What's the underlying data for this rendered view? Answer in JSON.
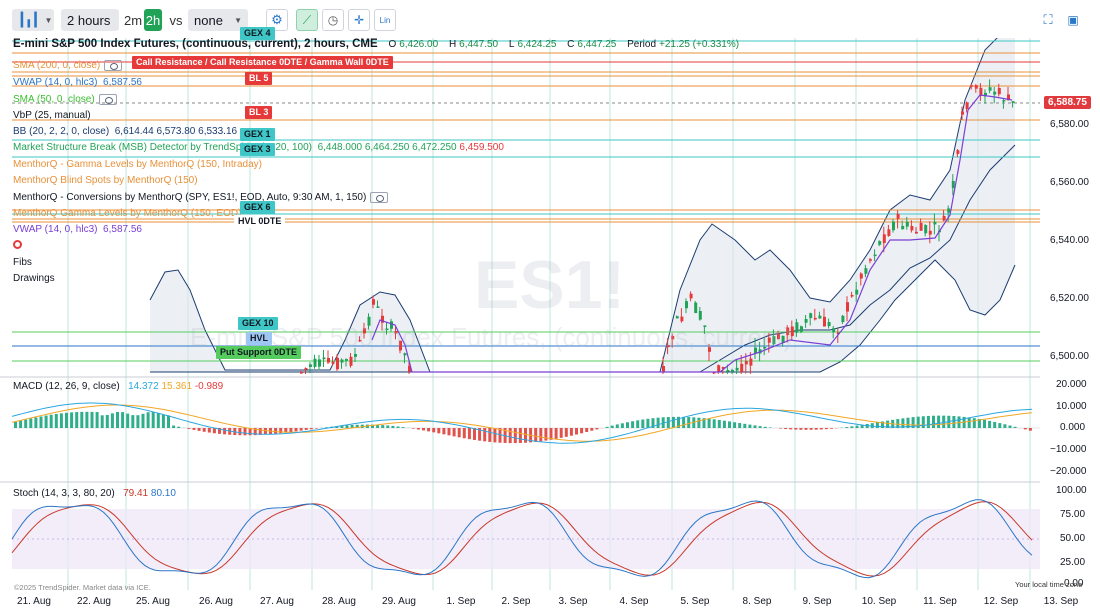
{
  "toolbar": {
    "interval_select": "2 hours",
    "interval_short_2m": "2m",
    "interval_short_2h": "2h",
    "compare_label": "vs",
    "compare_select": "none",
    "scale_label": "Lin"
  },
  "legend": {
    "title": "E-mini S&P 500 Index Futures, (continuous, current), 2 hours, CME",
    "open_label": "O",
    "open_value": "6,426.00",
    "high_label": "H",
    "high_value": "6,447.50",
    "low_label": "L",
    "low_value": "6,424.25",
    "close_label": "C",
    "close_value": "6,447.25",
    "period_label": "Period",
    "period_value": "+21.25 (+0.331%)",
    "indicators": [
      {
        "label": "SMA (200, 0, close)",
        "color": "#e8913a"
      },
      {
        "label": "VWAP (14, 0, hlc3)",
        "value": "6,587.56",
        "color": "#2a76c9"
      },
      {
        "label": "SMA (50, 0, close)",
        "color": "#3cbf2f"
      },
      {
        "label": "VbP (25, manual)",
        "color": "#131722"
      },
      {
        "label": "BB (20, 2, 2, 0, close)",
        "value": "6,614.44  6,573.80  6,533.16",
        "color": "#1b3c70"
      },
      {
        "label": "Market Structure Break (MSB) Detector by TrendSpider (3, 20, 100)",
        "value_green": "6,448.000  6,464.250  6,472.250",
        "value_red": "6,459.500",
        "color": "#21a357"
      },
      {
        "label": "MenthorQ - Gamma Levels by MenthorQ (150, Intraday)",
        "color": "#e8913a"
      },
      {
        "label": "MenthorQ Blind Spots by MenthorQ (150)",
        "color": "#e8913a"
      },
      {
        "label": "MenthorQ - Conversions by MenthorQ (SPY, ES1!, EOD, Auto, 9:30 AM, 1, 150)",
        "color": "#131722"
      },
      {
        "label": "MenthorQ Gamma Levels by MenthorQ (150, EOD)",
        "color": "#e8913a"
      },
      {
        "label": "VWAP (14, 0, hlc3)",
        "value": "6,587.56",
        "color": "#7b3fd6"
      },
      {
        "label": "Fibs",
        "color": "#131722"
      },
      {
        "label": "Drawings",
        "color": "#131722"
      }
    ]
  },
  "levels": {
    "gex4": "GEX 4",
    "call_resistance": "Call Resistance / Call Resistance 0DTE / Gamma Wall 0DTE",
    "bl5": "BL 5",
    "bl3": "BL 3",
    "gex1": "GEX 1",
    "gex3": "GEX 3",
    "gex6": "GEX 6",
    "hvl_0dte": "HVL 0DTE",
    "gex10": "GEX 10",
    "hvl": "HVL",
    "put_support": "Put Support 0DTE"
  },
  "last_price": "6,588.75",
  "watermark": {
    "symbol": "ES1!",
    "name": "E-mini S&P 500 Index Futures, (continuous, current)"
  },
  "price_axis": [
    "6,580.00",
    "6,560.00",
    "6,540.00",
    "6,520.00",
    "6,500.00"
  ],
  "macd": {
    "label": "MACD (12, 26, 9, close)",
    "v1": "14.372",
    "v2": "15.361",
    "v3": "-0.989",
    "axis": [
      "20.000",
      "10.000",
      "0.000",
      "−10.000",
      "−20.000"
    ]
  },
  "stoch": {
    "label": "Stoch (14, 3, 3, 80, 20)",
    "k": "79.41",
    "d": "80.10",
    "axis": [
      "100.00",
      "75.00",
      "50.00",
      "25.00",
      "0.00"
    ]
  },
  "x_axis": [
    "21. Aug",
    "22. Aug",
    "25. Aug",
    "26. Aug",
    "27. Aug",
    "28. Aug",
    "29. Aug",
    "1. Sep",
    "2. Sep",
    "3. Sep",
    "4. Sep",
    "5. Sep",
    "8. Sep",
    "9. Sep",
    "10. Sep",
    "11. Sep",
    "12. Sep",
    "13. Sep"
  ],
  "footer": {
    "copyright": "©2025 TrendSpider. Market data via ICE.",
    "timezone": "Your local time zone"
  },
  "colors": {
    "up": "#21a357",
    "down": "#e6393a",
    "bb": "#1b3c70",
    "vwap": "#7b3fd6",
    "macd": "#2aa6e0",
    "signal": "#f2a623",
    "stoch_k": "#2a76c9",
    "stoch_d": "#c9382a"
  }
}
